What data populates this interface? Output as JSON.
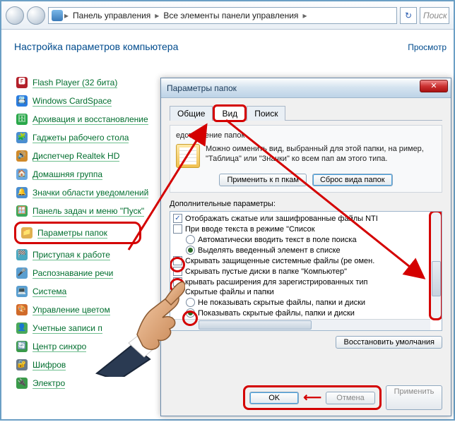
{
  "topbar": {
    "breadcrumb1": "Панель управления",
    "breadcrumb2": "Все элементы панели управления",
    "search_placeholder": "Поиск"
  },
  "cp": {
    "title": "Настройка параметров компьютера",
    "view_label": "Просмотр",
    "items": [
      {
        "label": "Flash Player (32 бита)",
        "icon": "🅵",
        "bg": "#b3202a"
      },
      {
        "label": "Windows CardSpace",
        "icon": "📇",
        "bg": "#2a7de0"
      },
      {
        "label": "Архивация и восстановление",
        "icon": "🗄",
        "bg": "#2aa84a"
      },
      {
        "label": "Гаджеты рабочего стола",
        "icon": "🧩",
        "bg": "#4a8ed0"
      },
      {
        "label": "Диспетчер Realtek HD",
        "icon": "🔊",
        "bg": "#d08a2a"
      },
      {
        "label": "Домашняя группа",
        "icon": "🏠",
        "bg": "#6aa8e0"
      },
      {
        "label": "Значки области уведомлений",
        "icon": "🔔",
        "bg": "#4a8ed0"
      },
      {
        "label": "Панель задач и меню \"Пуск\"",
        "icon": "🪟",
        "bg": "#3aa85a"
      },
      {
        "label": "Параметры папок",
        "icon": "📁",
        "bg": "#e0b050",
        "highlight": true
      },
      {
        "label": "Приступая к работе",
        "icon": "🏁",
        "bg": "#4aa8c0"
      },
      {
        "label": "Распознавание речи",
        "icon": "🎤",
        "bg": "#5a9ed0"
      },
      {
        "label": "Система",
        "icon": "💻",
        "bg": "#5a9ed0"
      },
      {
        "label": "Управление цветом",
        "icon": "🎨",
        "bg": "#d06a2a"
      },
      {
        "label": "Учетные записи п",
        "icon": "👤",
        "bg": "#4aa85a"
      },
      {
        "label": "Центр синхро",
        "icon": "🔄",
        "bg": "#3a9a4a"
      },
      {
        "label": "Шифров",
        "icon": "🔐",
        "bg": "#6a7a8a"
      },
      {
        "label": "Электро",
        "icon": "🔌",
        "bg": "#3a9a4a"
      }
    ]
  },
  "dialog": {
    "title": "Параметры папок",
    "tabs": [
      "Общие",
      "Вид",
      "Поиск"
    ],
    "rep_legend": "едставление папок",
    "rep_text": "Можно оименить вид, выбранный для этой папки, на ример, \"Таблица\" или \"Значки\" ко всем пап ам этого типа.",
    "btn_apply_folders": "Применить к п пкам",
    "btn_reset_folders": "Сброс вида папок",
    "adv_label": "Дополнительные параметры:",
    "tree": [
      {
        "type": "checkbox",
        "checked": true,
        "indent": 0,
        "text": "Отображать сжатые или зашифрованные файлы NTI"
      },
      {
        "type": "checkbox",
        "checked": false,
        "indent": 0,
        "text": "При вводе текста в режиме \"Список"
      },
      {
        "type": "radio",
        "checked": false,
        "indent": 1,
        "text": "Автоматически вводить текст в поле поиска"
      },
      {
        "type": "radio",
        "checked": true,
        "indent": 1,
        "text": "Выделять введенный элемент в списке"
      },
      {
        "type": "checkbox",
        "checked": false,
        "indent": 0,
        "text": "Скрывать защищенные системные файлы (ре омен.",
        "hl": true
      },
      {
        "type": "checkbox",
        "checked": false,
        "indent": 0,
        "text": "Скрывать пустые диски в папке \"Компьютер\""
      },
      {
        "type": "checkbox",
        "checked": false,
        "indent": 0,
        "text": "крывать расширения для зарегистрированных тип",
        "hl": true
      },
      {
        "type": "label",
        "indent": 0,
        "text": "Скрытые файлы и папки"
      },
      {
        "type": "radio",
        "checked": false,
        "indent": 1,
        "text": "Не показывать скрытые файлы, папки и диски"
      },
      {
        "type": "radio",
        "checked": true,
        "indent": 1,
        "text": "Показывать скрытые файлы, папки и диски",
        "hl": true
      }
    ],
    "btn_restore": "Восстановить умолчания",
    "btn_ok": "OK",
    "btn_cancel": "Отмена",
    "btn_apply": "Применить"
  }
}
